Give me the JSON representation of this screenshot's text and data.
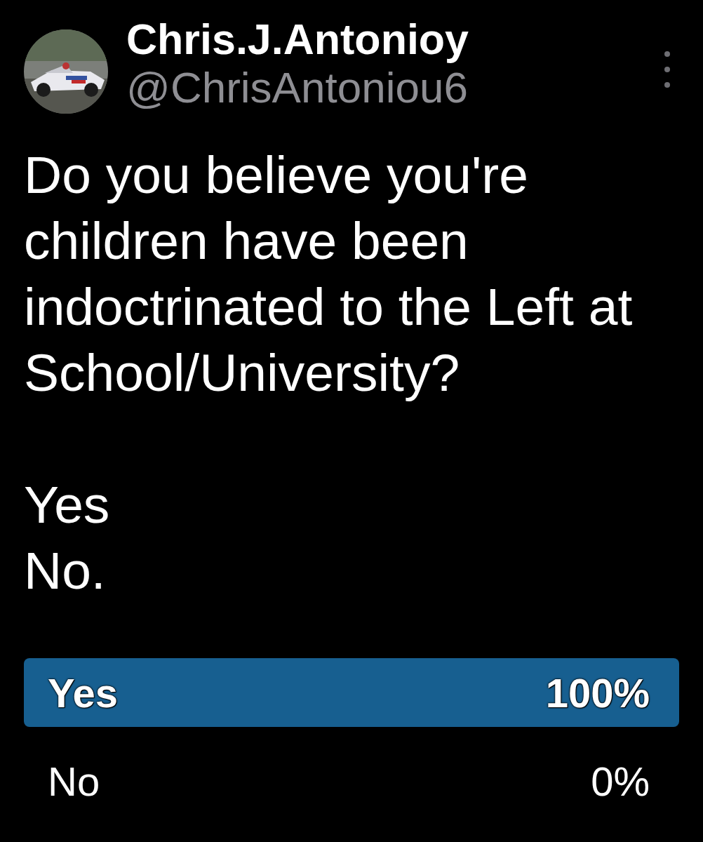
{
  "author": {
    "name": "Chris.J.Antonioy",
    "handle": "@ChrisAntoniou6"
  },
  "post": {
    "text": "Do you believe you're\nchildren have been\nindoctrinated to the Left at\nSchool/University?\n\nYes\nNo."
  },
  "poll": {
    "options": [
      {
        "label": "Yes",
        "percent": "100%",
        "leading": true
      },
      {
        "label": "No",
        "percent": "0%",
        "leading": false
      }
    ]
  }
}
